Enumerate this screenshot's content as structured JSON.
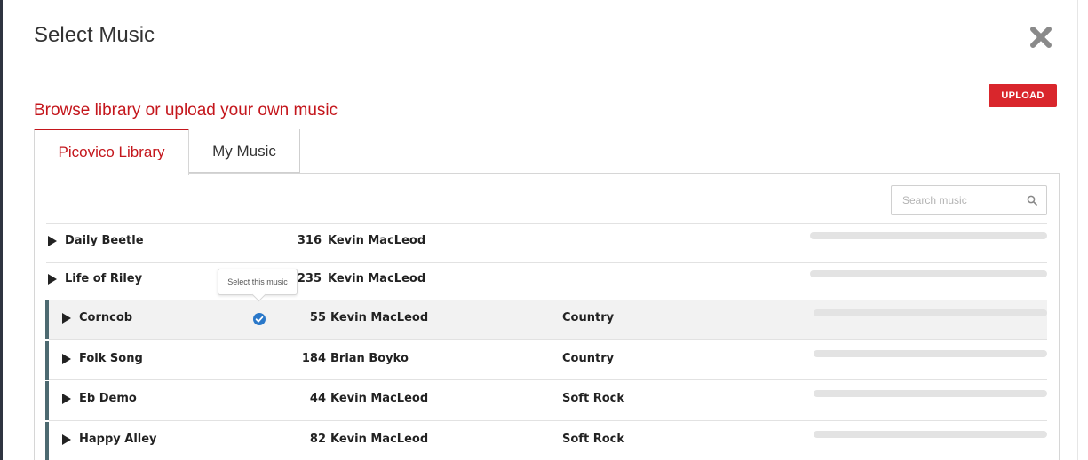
{
  "modal": {
    "title": "Select Music",
    "subtitle": "Browse library or upload your own music",
    "upload_label": "UPLOAD"
  },
  "tabs": [
    {
      "label": "Picovico Library",
      "active": true
    },
    {
      "label": "My Music",
      "active": false
    }
  ],
  "search": {
    "placeholder": "Search music",
    "value": ""
  },
  "tooltip": "Select this music",
  "colors": {
    "accent": "#c4161c",
    "upload_bg": "#d9262c",
    "selected_check": "#2a78c9",
    "row_marker": "#4d6a71"
  },
  "tracks": [
    {
      "name": "Daily Beetle",
      "plays": "316",
      "artist": "Kevin MacLeod",
      "genre": ""
    },
    {
      "name": "Life of Riley",
      "plays": "235",
      "artist": "Kevin MacLeod",
      "genre": ""
    },
    {
      "name": "Corncob",
      "plays": "55",
      "artist": "Kevin MacLeod",
      "genre": "Country",
      "selected": true
    },
    {
      "name": "Folk Song",
      "plays": "184",
      "artist": "Brian Boyko",
      "genre": "Country"
    },
    {
      "name": "Eb Demo",
      "plays": "44",
      "artist": "Kevin MacLeod",
      "genre": "Soft Rock"
    },
    {
      "name": "Happy Alley",
      "plays": "82",
      "artist": "Kevin MacLeod",
      "genre": "Soft Rock"
    }
  ]
}
